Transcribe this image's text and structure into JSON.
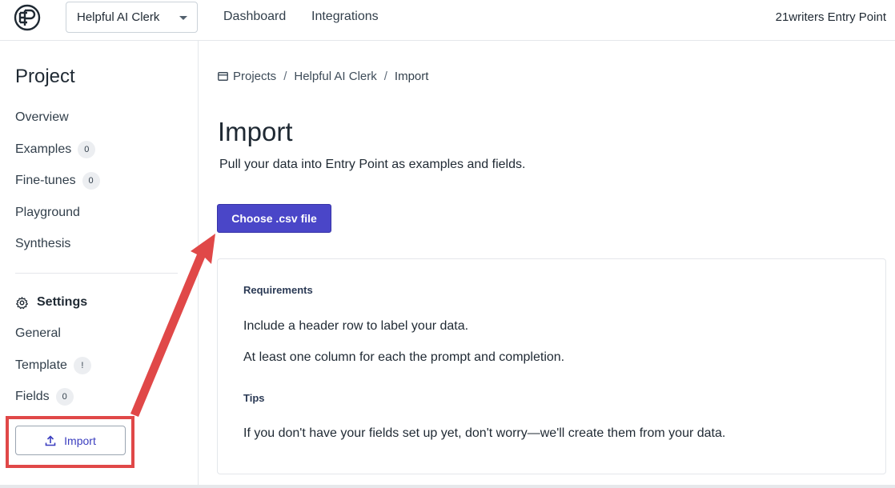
{
  "topbar": {
    "logo_icon": "ep-logo",
    "project_select": "Helpful AI Clerk",
    "nav": [
      "Dashboard",
      "Integrations"
    ],
    "org_name": "21writers Entry Point"
  },
  "sidebar": {
    "title": "Project",
    "items": [
      {
        "label": "Overview"
      },
      {
        "label": "Examples",
        "badge": "0"
      },
      {
        "label": "Fine-tunes",
        "badge": "0"
      },
      {
        "label": "Playground"
      },
      {
        "label": "Synthesis"
      }
    ],
    "settings_label": "Settings",
    "settings_icon": "gear-icon",
    "settings_items": [
      {
        "label": "General"
      },
      {
        "label": "Template",
        "badge": "!"
      },
      {
        "label": "Fields",
        "badge": "0"
      }
    ],
    "import_label": "Import",
    "import_icon": "upload-icon"
  },
  "breadcrumb": {
    "items": [
      "Projects",
      "Helpful AI Clerk",
      "Import"
    ],
    "separator": "/",
    "icon": "projects-icon"
  },
  "main": {
    "title": "Import",
    "subtitle": "Pull your data into Entry Point as examples and fields.",
    "choose_button": "Choose .csv file",
    "requirements_heading": "Requirements",
    "requirements": [
      "Include a header row to label your data.",
      "At least one column for each the prompt and completion."
    ],
    "tips_heading": "Tips",
    "tips": [
      "If you don't have your fields set up yet, don't worry—we'll create them from your data."
    ]
  },
  "colors": {
    "accent": "#4a46c8",
    "annotation": "#e04848"
  }
}
